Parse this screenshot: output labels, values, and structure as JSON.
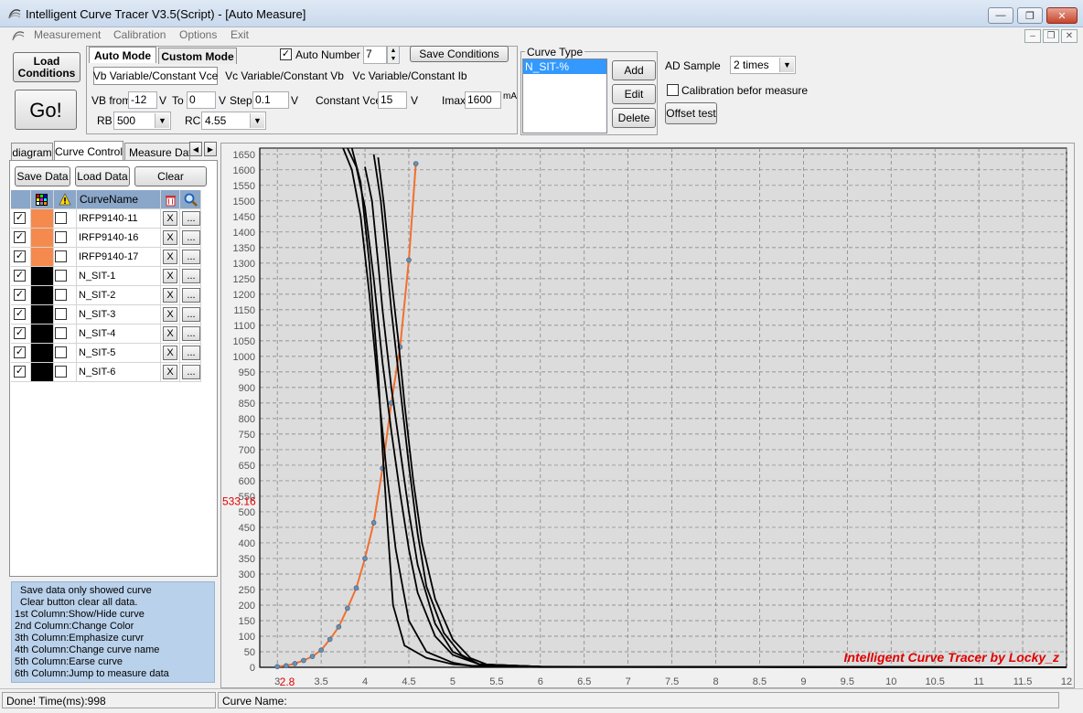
{
  "window": {
    "title": "Intelligent Curve Tracer V3.5(Script) - [Auto Measure]"
  },
  "menu": [
    "Measurement",
    "Calibration",
    "Options",
    "Exit"
  ],
  "toolbar": {
    "load_conditions": "Load Conditions",
    "go": "Go!",
    "mode_tabs": [
      "Auto Mode",
      "Custom Mode"
    ],
    "auto_number_label": "Auto Number",
    "auto_number_value": "7",
    "save_conditions": "Save Conditions",
    "sub_tabs": [
      "Vb Variable/Constant Vce",
      "Vc Variable/Constant Vb",
      "Vc Variable/Constant Ib"
    ],
    "vb_from_label": "VB from",
    "vb_from_value": "-12",
    "unit_v": "V",
    "to_label": "To",
    "to_value": "0",
    "step_label": "Step",
    "step_value": "0.1",
    "constant_vce_label": "Constant Vce",
    "constant_vce_value": "15",
    "imax_label": "Imax",
    "imax_value": "1600",
    "unit_ma": "mA",
    "rb_label": "RB",
    "rb_value": "500",
    "rc_label": "RC",
    "rc_value": "4.55"
  },
  "curve_type": {
    "legend": "Curve Type",
    "items": [
      "N_SIT-%"
    ],
    "add": "Add",
    "edit": "Edit",
    "delete": "Delete"
  },
  "ad_sample": {
    "label": "AD Sample",
    "value": "2 times",
    "calibration_label": "Calibration befor measure",
    "offset_test": "Offset test"
  },
  "left_tabs": [
    "diagram",
    "Curve Control",
    "Measure Data"
  ],
  "left_buttons": {
    "save_data": "Save Data",
    "load_data": "Load Data",
    "clear": "Clear"
  },
  "table": {
    "header_name": "CurveName",
    "erase_label": "X",
    "jump_label": "...",
    "rows": [
      {
        "name": "IRFP9140-11",
        "color": "#f58a4e"
      },
      {
        "name": "IRFP9140-16",
        "color": "#f58a4e"
      },
      {
        "name": "IRFP9140-17",
        "color": "#f58a4e"
      },
      {
        "name": "N_SIT-1",
        "color": "#000000"
      },
      {
        "name": "N_SIT-2",
        "color": "#000000"
      },
      {
        "name": "N_SIT-3",
        "color": "#000000"
      },
      {
        "name": "N_SIT-4",
        "color": "#000000"
      },
      {
        "name": "N_SIT-5",
        "color": "#000000"
      },
      {
        "name": "N_SIT-6",
        "color": "#000000"
      }
    ]
  },
  "help_lines": [
    "Save data only showed curve",
    "Clear button clear all data.",
    "1st Column:Show/Hide curve",
    "2nd Column:Change Color",
    "3th Column:Emphasize curvr",
    "4th Column:Change curve name",
    "5th Column:Earse curve",
    "6th Column:Jump to measure data"
  ],
  "chart_data": {
    "type": "line",
    "title": "",
    "xlabel": "",
    "ylabel": "",
    "xlim": [
      2.8,
      12
    ],
    "ylim": [
      0,
      1670
    ],
    "x_ticks": [
      3,
      3.5,
      4,
      4.5,
      5,
      5.5,
      6,
      6.5,
      7,
      7.5,
      8,
      8.5,
      9,
      9.5,
      10,
      10.5,
      11,
      11.5,
      12
    ],
    "y_ticks": [
      0,
      50,
      100,
      150,
      200,
      250,
      300,
      350,
      400,
      450,
      500,
      550,
      600,
      650,
      700,
      750,
      800,
      850,
      900,
      950,
      1000,
      1050,
      1100,
      1150,
      1200,
      1250,
      1300,
      1350,
      1400,
      1450,
      1500,
      1550,
      1600,
      1650
    ],
    "cursor_x_label": "2.8",
    "cursor_y_label": "533.16",
    "grid": true,
    "background": "#dcdcdc",
    "watermark": "Intelligent Curve Tracer by Locky_z",
    "series": [
      {
        "color": "#f07030",
        "markers": true,
        "x": [
          3.0,
          3.1,
          3.2,
          3.3,
          3.4,
          3.5,
          3.6,
          3.7,
          3.8,
          3.9,
          4.0,
          4.1,
          4.2,
          4.3,
          4.4,
          4.5,
          4.58
        ],
        "y": [
          2,
          5,
          12,
          22,
          35,
          55,
          90,
          130,
          190,
          255,
          350,
          465,
          640,
          850,
          1030,
          1310,
          1620
        ]
      },
      {
        "color": "#000000",
        "markers": false,
        "x": [
          3.75,
          3.85,
          3.95,
          4.05,
          4.15,
          4.25,
          4.35,
          4.5,
          4.7,
          5.0,
          5.2,
          6.0,
          12.0
        ],
        "y": [
          1670,
          1600,
          1450,
          1200,
          900,
          620,
          380,
          150,
          50,
          15,
          5,
          2,
          0
        ]
      },
      {
        "color": "#000000",
        "markers": false,
        "x": [
          3.85,
          3.95,
          4.05,
          4.15,
          4.2,
          4.27,
          4.32,
          4.45,
          4.7,
          5.0,
          5.3,
          6.0,
          12.0
        ],
        "y": [
          1670,
          1560,
          1300,
          950,
          700,
          400,
          200,
          70,
          30,
          10,
          3,
          1,
          0
        ]
      },
      {
        "color": "#000000",
        "markers": false,
        "x": [
          3.8,
          3.9,
          4.0,
          4.1,
          4.2,
          4.3,
          4.4,
          4.5,
          4.6,
          4.8,
          5.0,
          5.3,
          6.0,
          12.0
        ],
        "y": [
          1670,
          1610,
          1480,
          1250,
          980,
          760,
          560,
          380,
          240,
          100,
          40,
          10,
          2,
          0
        ]
      },
      {
        "color": "#000000",
        "markers": false,
        "x": [
          4.0,
          4.08,
          4.15,
          4.2,
          4.3,
          4.4,
          4.5,
          4.6,
          4.8,
          5.0,
          5.3,
          6.0,
          12.0
        ],
        "y": [
          1610,
          1500,
          1300,
          1150,
          900,
          700,
          500,
          330,
          140,
          50,
          10,
          2,
          0
        ]
      },
      {
        "color": "#000000",
        "markers": false,
        "x": [
          4.1,
          4.18,
          4.25,
          4.3,
          4.4,
          4.5,
          4.6,
          4.7,
          4.9,
          5.1,
          5.3,
          6.0,
          12.0
        ],
        "y": [
          1650,
          1500,
          1300,
          1150,
          900,
          650,
          430,
          260,
          110,
          40,
          10,
          2,
          0
        ]
      },
      {
        "color": "#000000",
        "markers": false,
        "x": [
          4.15,
          4.22,
          4.3,
          4.38,
          4.45,
          4.55,
          4.65,
          4.8,
          5.0,
          5.2,
          5.4,
          6.0,
          12.0
        ],
        "y": [
          1640,
          1480,
          1250,
          1050,
          850,
          600,
          400,
          220,
          90,
          30,
          8,
          2,
          0
        ]
      }
    ]
  }
}
